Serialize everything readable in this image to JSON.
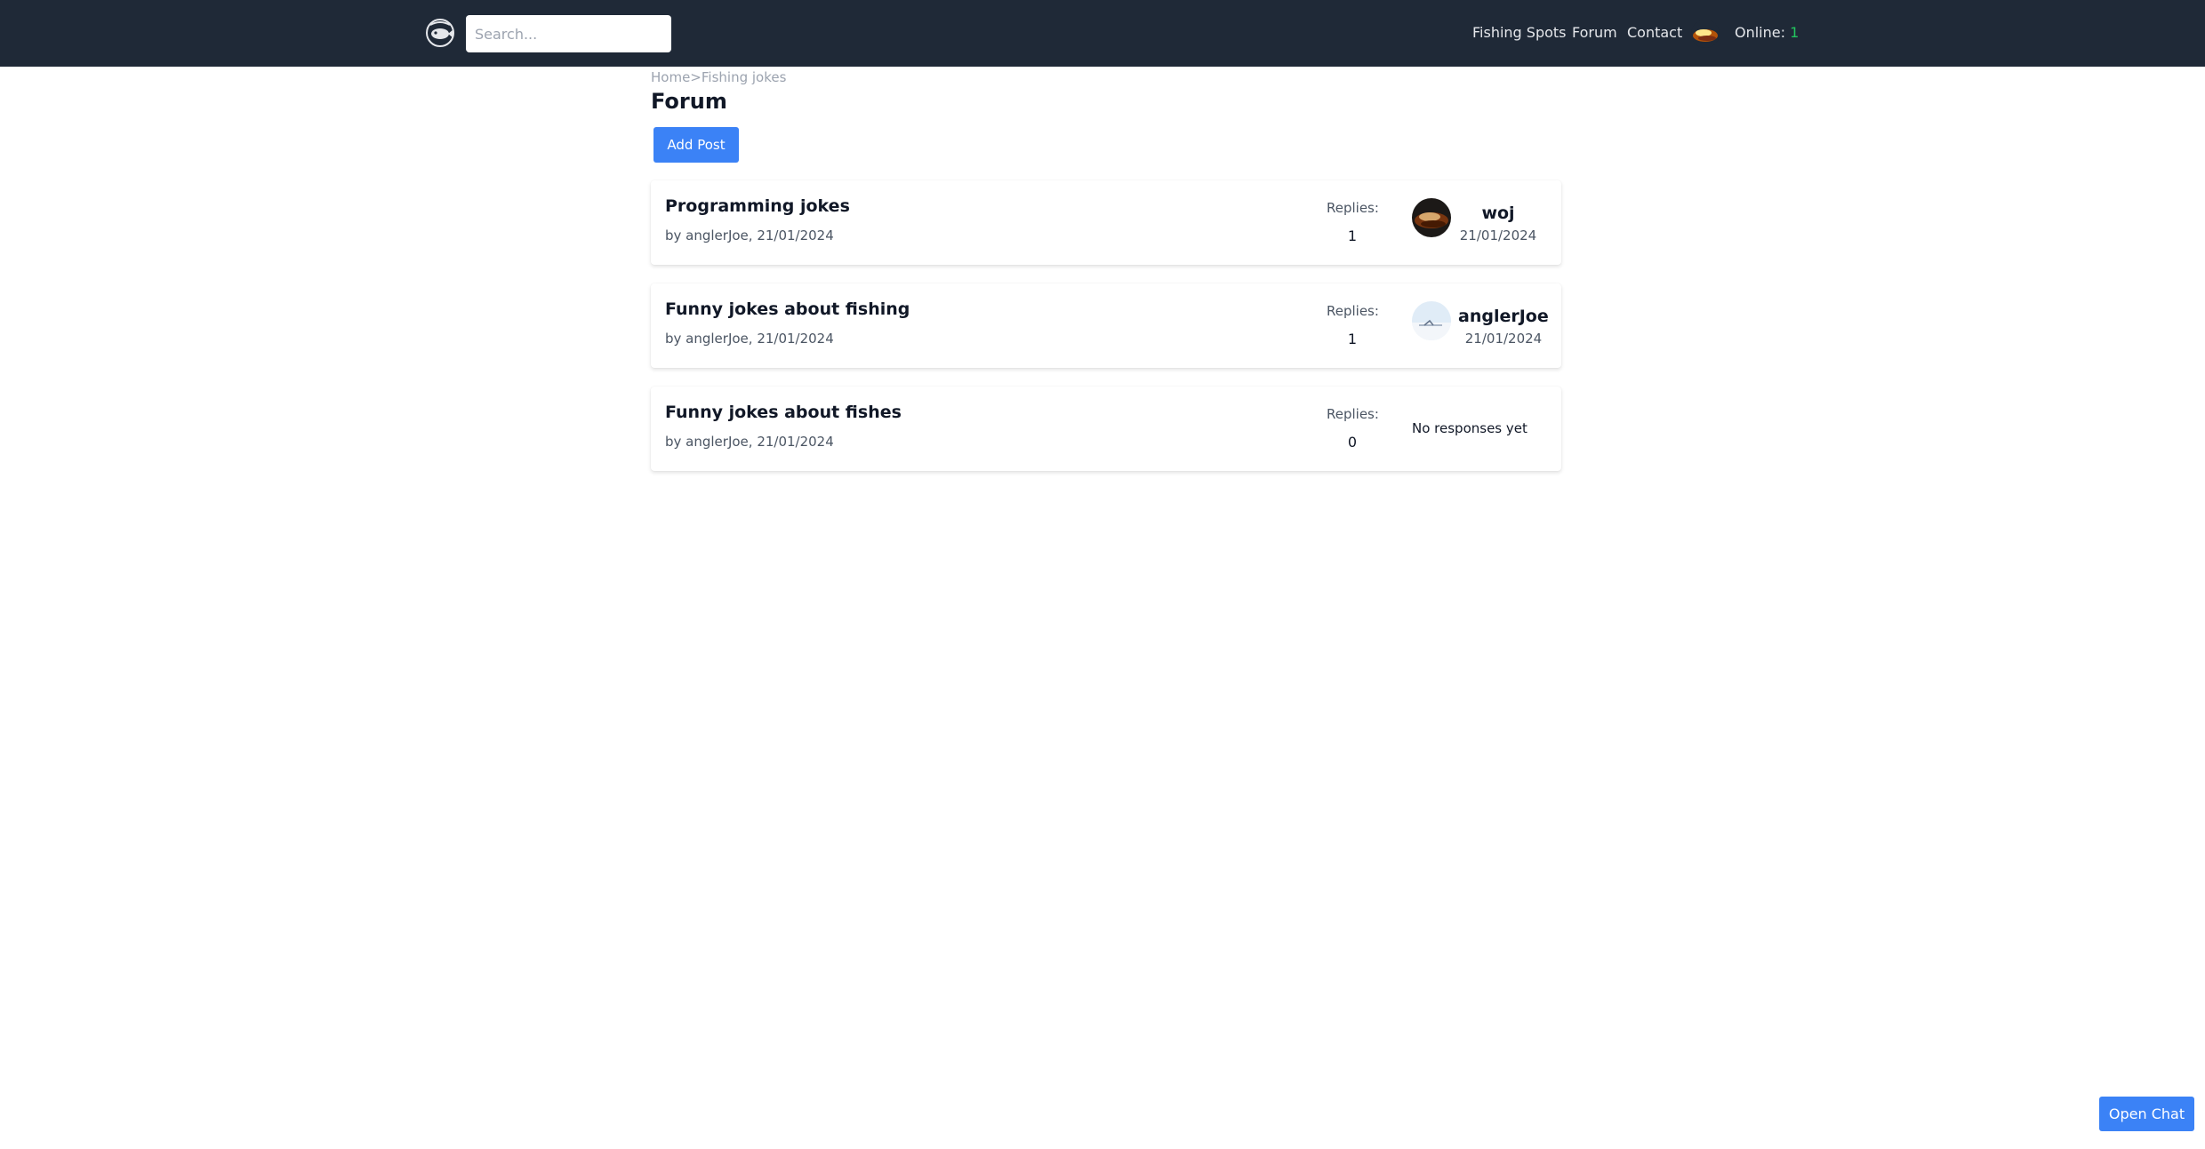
{
  "navbar": {
    "logo_icon": "fish-logo-icon",
    "search_placeholder": "Search...",
    "links": [
      "Fishing Spots",
      "Forum",
      "Contact"
    ],
    "avatar_icon": "user-avatar-icon",
    "online_label": "Online:",
    "online_count": "1"
  },
  "breadcrumb": {
    "home": "Home",
    "separator": ">",
    "current": "Fishing jokes"
  },
  "page": {
    "title": "Forum",
    "add_post_label": "Add Post"
  },
  "posts": [
    {
      "title": "Programming jokes",
      "meta": "by anglerJoe, 21/01/2024",
      "replies_label": "Replies:",
      "replies": "1",
      "last_user": "woj",
      "last_date": "21/01/2024",
      "last_avatar": "brown-avatar"
    },
    {
      "title": "Funny jokes about fishing",
      "meta": "by anglerJoe, 21/01/2024",
      "replies_label": "Replies:",
      "replies": "1",
      "last_user": "anglerJoe",
      "last_date": "21/01/2024",
      "last_avatar": "light-avatar"
    },
    {
      "title": "Funny jokes about fishes",
      "meta": "by anglerJoe, 21/01/2024",
      "replies_label": "Replies:",
      "replies": "0",
      "no_responses": "No responses yet"
    }
  ],
  "chat": {
    "open_label": "Open Chat"
  },
  "colors": {
    "navbar_bg": "#1f2937",
    "accent": "#3b82f6",
    "online": "#22c55e"
  }
}
